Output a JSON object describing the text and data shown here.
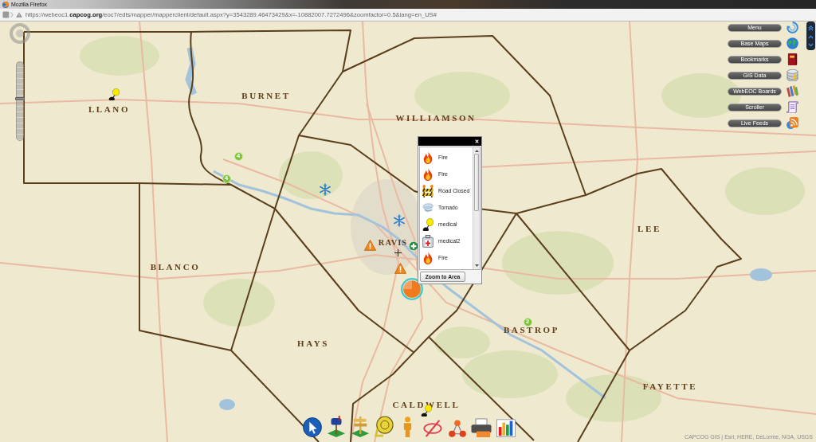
{
  "window": {
    "title": "Mozilla Firefox"
  },
  "address_bar": {
    "url": "https://webeoc1.**capcog.org**/eoc7/edts/mapper/mapperclient/default.aspx?y=3543289.46473429&x=-10882007.7272496&zoomfactor=0.5&lang=en_US#"
  },
  "map": {
    "county_labels": [
      "LLANO",
      "BURNET",
      "WILLIAMSON",
      "BLANCO",
      "RAVIS",
      "HAYS",
      "BASTROP",
      "LEE",
      "CALDWELL",
      "FAYETTE"
    ],
    "markers": [
      {
        "kind": "medical"
      },
      {
        "kind": "cluster",
        "count": "4"
      },
      {
        "kind": "cluster",
        "count": "4"
      },
      {
        "kind": "snowflake"
      },
      {
        "kind": "snowflake"
      },
      {
        "kind": "warning"
      },
      {
        "kind": "plus"
      },
      {
        "kind": "crosshair"
      },
      {
        "kind": "warning"
      },
      {
        "kind": "incident"
      },
      {
        "kind": "cluster",
        "count": "2"
      },
      {
        "kind": "medical"
      }
    ],
    "zoom_slider": {
      "level": 0.53
    },
    "attribution": "CAPCOG GIS | Esri, HERE, DeLorme, NGA, USGS"
  },
  "side_menu": {
    "buttons": [
      "Menu",
      "Base Maps",
      "Bookmarks",
      "GIS Data",
      "WebEOC Boards",
      "Scroller",
      "Live Feeds"
    ]
  },
  "popup": {
    "items": [
      {
        "label": "Fire",
        "kind": "fire"
      },
      {
        "label": "Fire",
        "kind": "fire"
      },
      {
        "label": "Road Closed",
        "kind": "road_closed"
      },
      {
        "label": "Tornado",
        "kind": "tornado"
      },
      {
        "label": "medical",
        "kind": "medical"
      },
      {
        "label": "medical2",
        "kind": "medical2"
      },
      {
        "label": "Fire",
        "kind": "fire"
      }
    ],
    "button": "Zoom to Area"
  }
}
